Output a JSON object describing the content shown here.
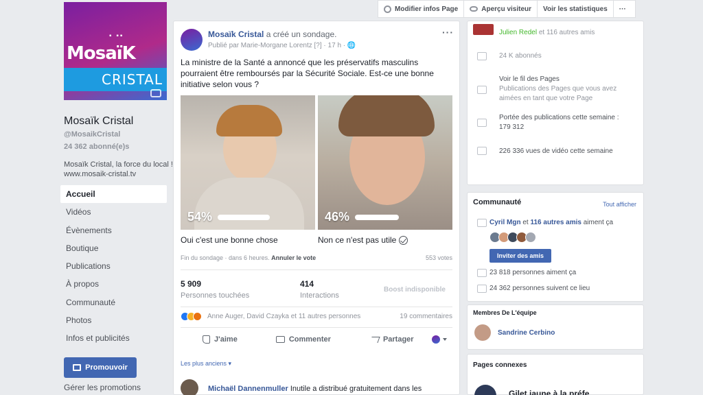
{
  "page": {
    "cover": {
      "logo_main": "MosaïK",
      "logo_sub": "CRISTAL",
      "logo_tv": "tv",
      "accent": "#1e9be0"
    },
    "name": "Mosaïk Cristal",
    "handle": "@MosaikCristal",
    "subscribers": "24 362 abonné(e)s",
    "description": "Mosaïk Cristal, la force du local ! www.mosaik-cristal.tv"
  },
  "nav": {
    "items": [
      {
        "label": "Accueil",
        "active": true
      },
      {
        "label": "Vidéos"
      },
      {
        "label": "Évènements"
      },
      {
        "label": "Boutique"
      },
      {
        "label": "Publications"
      },
      {
        "label": "À propos"
      },
      {
        "label": "Communauté"
      },
      {
        "label": "Photos"
      },
      {
        "label": "Infos et publicités"
      }
    ],
    "promote_label": "Promouvoir",
    "manage_promotions": "Gérer les promotions"
  },
  "topbar": {
    "edit_info": "Modifier infos Page",
    "view_as": "Aperçu visiteur",
    "stats": "Voir les statistiques",
    "more": "···"
  },
  "post": {
    "author": "Mosaïk Cristal",
    "action": "a créé un sondage.",
    "published_by": "Publié par Marie-Morgane Lorentz",
    "help": "[?]",
    "time": "17 h",
    "text": "La ministre de la Santé a annoncé que les préservatifs masculins pourraient être remboursés par la Sécurité Sociale. Est-ce une bonne initiative selon vous ?",
    "poll": {
      "options": [
        {
          "label": "Oui c'est une bonne chose",
          "percent": 54,
          "percent_text": "54%"
        },
        {
          "label": "Non ce n'est pas utile",
          "percent": 46,
          "percent_text": "46%",
          "selected": true
        }
      ],
      "end_text": "Fin du sondage · dans 6 heures.",
      "undo": "Annuler le vote",
      "votes": "553 votes"
    },
    "stats": {
      "reached_value": "5 909",
      "reached_label": "Personnes touchées",
      "interactions_value": "414",
      "interactions_label": "Interactions",
      "boost": "Boost indisponible"
    },
    "reactions_text": "Anne Auger, David Czayka et 11 autres personnes",
    "comments_count": "19 commentaires",
    "actions": {
      "like": "J'aime",
      "comment": "Commenter",
      "share": "Partager"
    },
    "comment_filter": "Les plus anciens ▾",
    "first_comment": {
      "author": "Michaël Dannenmuller",
      "text": "Inutile a distribué gratuitement dans les"
    }
  },
  "right": {
    "friend_like": {
      "name": "Julien Redel",
      "rest": "et 116 autres amis"
    },
    "followers": "24 K abonnés",
    "feed_title": "Voir le fil des Pages",
    "feed_desc": "Publications des Pages que vous avez aimées en tant que votre Page",
    "reach_title": "Portée des publications cette semaine :",
    "reach_value": "179 312",
    "video_views": "226 336 vues de vidéo cette semaine",
    "community": {
      "title": "Communauté",
      "see_all": "Tout afficher",
      "friends_a": "Cyril Mgn",
      "friends_mid": "et",
      "friends_b": "116 autres amis",
      "friends_end": "aiment ça",
      "invite": "Inviter des amis",
      "likes": "23 818 personnes aiment ça",
      "follows": "24 362 personnes suivent ce lieu"
    },
    "team": {
      "title": "Membres De L'équipe",
      "member": "Sandrine Cerbino"
    },
    "related": {
      "title": "Pages connexes",
      "page": "Gilet jaune à la préfe…"
    }
  }
}
